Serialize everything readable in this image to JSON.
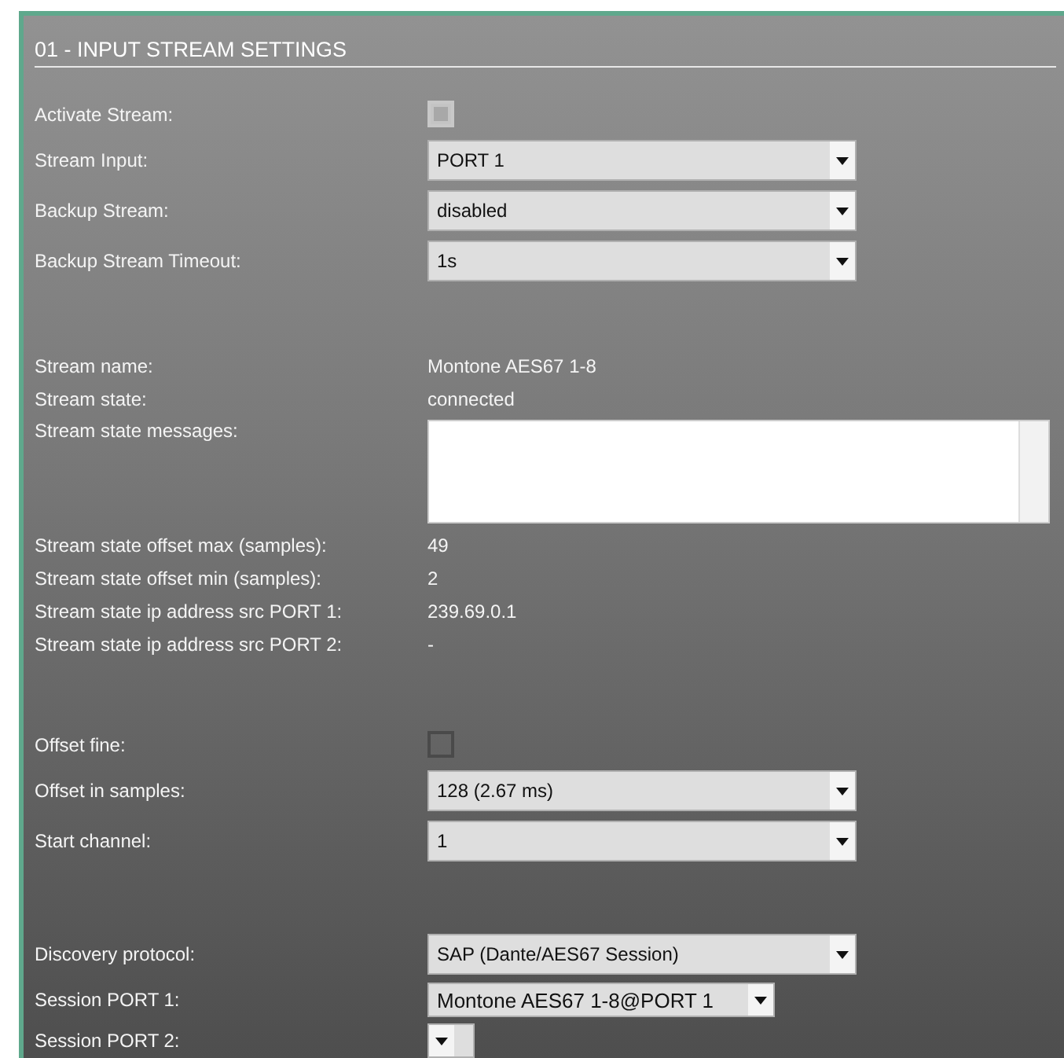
{
  "panel": {
    "title": "01 - INPUT STREAM SETTINGS"
  },
  "groups": [
    [
      {
        "kind": "checkbox",
        "label": "Activate Stream:",
        "checked": true
      },
      {
        "kind": "select",
        "label": "Stream Input:",
        "value": "PORT 1"
      },
      {
        "kind": "select",
        "label": "Backup Stream:",
        "value": "disabled"
      },
      {
        "kind": "select",
        "label": "Backup Stream Timeout:",
        "value": "1s"
      }
    ],
    [
      {
        "kind": "text",
        "label": "Stream name:",
        "value": "Montone AES67 1-8"
      },
      {
        "kind": "text",
        "label": "Stream state:",
        "value": "connected"
      },
      {
        "kind": "textarea",
        "label": "Stream state messages:"
      },
      {
        "kind": "text",
        "label": "Stream state offset max (samples):",
        "value": "49"
      },
      {
        "kind": "text",
        "label": "Stream state offset min (samples):",
        "value": "2"
      },
      {
        "kind": "text",
        "label": "Stream state ip address src PORT 1:",
        "value": "239.69.0.1"
      },
      {
        "kind": "text",
        "label": "Stream state ip address src PORT 2:",
        "value": "-"
      }
    ],
    [
      {
        "kind": "checkbox",
        "label": "Offset fine:",
        "checked": false
      },
      {
        "kind": "select",
        "label": "Offset in samples:",
        "value": "128 (2.67 ms)"
      },
      {
        "kind": "select",
        "label": "Start channel:",
        "value": "1"
      }
    ],
    [
      {
        "kind": "select",
        "label": "Discovery protocol:",
        "value": "SAP (Dante/AES67 Session)"
      },
      {
        "kind": "compact-select",
        "label": "Session PORT 1:",
        "value": "Montone AES67 1-8@PORT 1"
      },
      {
        "kind": "compact-select",
        "label": "Session PORT 2:"
      }
    ]
  ]
}
